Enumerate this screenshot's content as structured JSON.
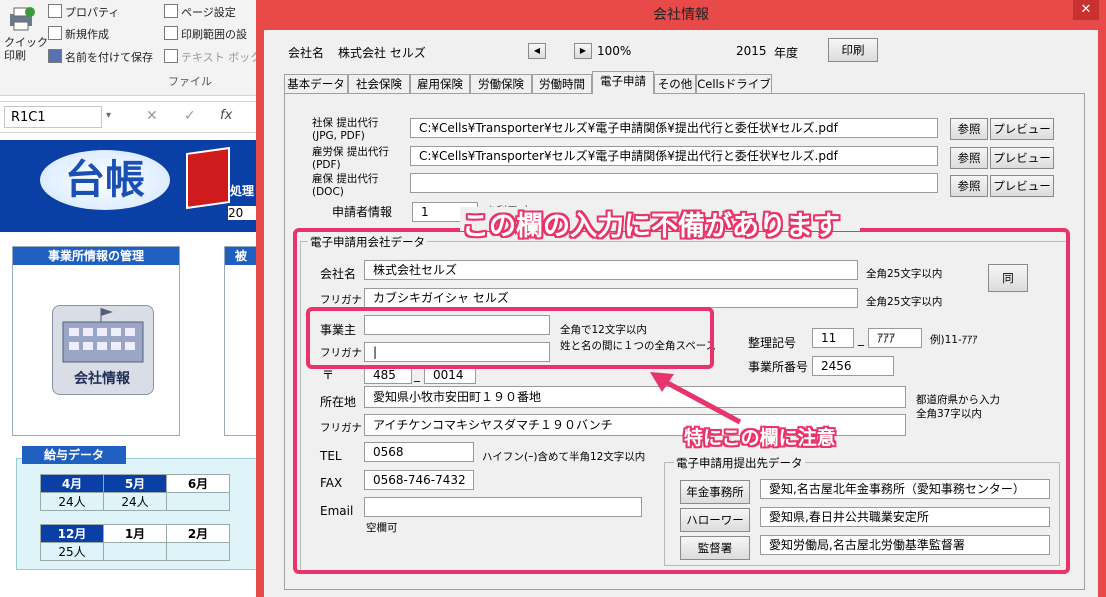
{
  "excel": {
    "ribbon": {
      "quick_print": "クイック\n印刷",
      "properties": "プロパティ",
      "new_create": "新規作成",
      "save_as": "名前を付けて保存",
      "page_setup": "ページ設定",
      "print_range": "印刷範囲の設",
      "text_box": "テキスト ボックス",
      "group_label": "ファイル"
    },
    "name_box": "R1C1",
    "formula_icons": [
      "✕",
      "✓",
      "fx"
    ],
    "logo_text": "台帳",
    "partial_right_text": "処理",
    "partial_year": "20",
    "office_panel_title": "事業所情報の管理",
    "second_panel_partial": "被",
    "company_info_button": "会社情報",
    "salary": {
      "title": "給与データ",
      "row1_months": [
        "4月",
        "5月",
        "6月"
      ],
      "row1_values": [
        "24人",
        "24人",
        ""
      ],
      "row2_months": [
        "12月",
        "1月",
        "2月"
      ],
      "row2_values": [
        "25人",
        "",
        ""
      ]
    }
  },
  "dialog": {
    "title": "会社情報",
    "close_glyph": "✕",
    "header": {
      "company_label": "会社名",
      "company_value": "株式会社 セルズ",
      "zoom": "100%",
      "year": "2015",
      "year_label": "年度",
      "print_button": "印刷"
    },
    "tabs": [
      "基本データ",
      "社会保険",
      "雇用保険",
      "労働保険",
      "労働時間",
      "電子申請",
      "その他",
      "Cellsドライブ"
    ],
    "active_tab": "電子申請",
    "proxy": {
      "rows": [
        {
          "label": "社保 提出代行\n(JPG, PDF)",
          "path": "C:¥Cells¥Transporter¥セルズ¥電子申請関係¥提出代行と委任状¥セルズ.pdf"
        },
        {
          "label": "雇労保 提出代行\n(PDF)",
          "path": "C:¥Cells¥Transporter¥セルズ¥電子申請関係¥提出代行と委任状¥セルズ.pdf"
        },
        {
          "label": "雇保 提出代行\n(DOC)",
          "path": ""
        }
      ],
      "browse_button": "参照",
      "preview_button": "プレビュー"
    },
    "applicant": {
      "label": "申請者情報",
      "value": "1",
      "partial_text": "を利用 方"
    },
    "edata": {
      "group_title": "電子申請用会社データ",
      "company_name_label": "会社名",
      "company_name_value": "株式会社セルズ",
      "company_name_note": "全角25文字以内",
      "furigana_label": "フリガナ",
      "furigana_value": "カブシキガイシャ セルズ",
      "furigana_note": "全角25文字以内",
      "same_button": "同",
      "owner_label": "事業主",
      "owner_value": "",
      "owner_furigana_label": "フリガナ",
      "owner_furigana_value": "|",
      "owner_note1": "全角で12文字以内",
      "owner_note2": "姓と名の間に１つの全角スペース",
      "seiri_label": "整理記号",
      "seiri_1": "11",
      "seiri_2": "ｱｱｱ",
      "seiri_example": "例)11-ｱｱｱ",
      "office_no_label": "事業所番号",
      "office_no_value": "2456",
      "zip_label": "〒",
      "zip_1": "485",
      "zip_2": "0014",
      "address_label": "所在地",
      "address_value": "愛知県小牧市安田町１９０番地",
      "address_note1": "都道府県から入力",
      "address_note2": "全角37字以内",
      "address_kana_label": "フリガナ",
      "address_kana_value": "アイチケンコマキシヤスダマチ１９０バンチ",
      "tel_label": "TEL",
      "tel_value": "0568",
      "tel_note": "ハイフン(ｰ)含めて半角12文字以内",
      "fax_label": "FAX",
      "fax_value": "0568-746-7432",
      "email_label": "Email",
      "email_value": "",
      "email_note": "空欄可",
      "dash": "_"
    },
    "submit": {
      "group_title": "電子申請用提出先データ",
      "rows": [
        {
          "button": "年金事務所",
          "value": "愛知,名古屋北年金事務所（愛知事務センター）"
        },
        {
          "button": "ハローワーク",
          "value": "愛知県,春日井公共職業安定所"
        },
        {
          "button": "監督署",
          "value": "愛知労働局,名古屋北労働基準監督署"
        }
      ]
    }
  },
  "annotations": {
    "main": "この欄の入力に不備があります",
    "sub": "特にこの欄に注意",
    "color": "#e8336b"
  }
}
